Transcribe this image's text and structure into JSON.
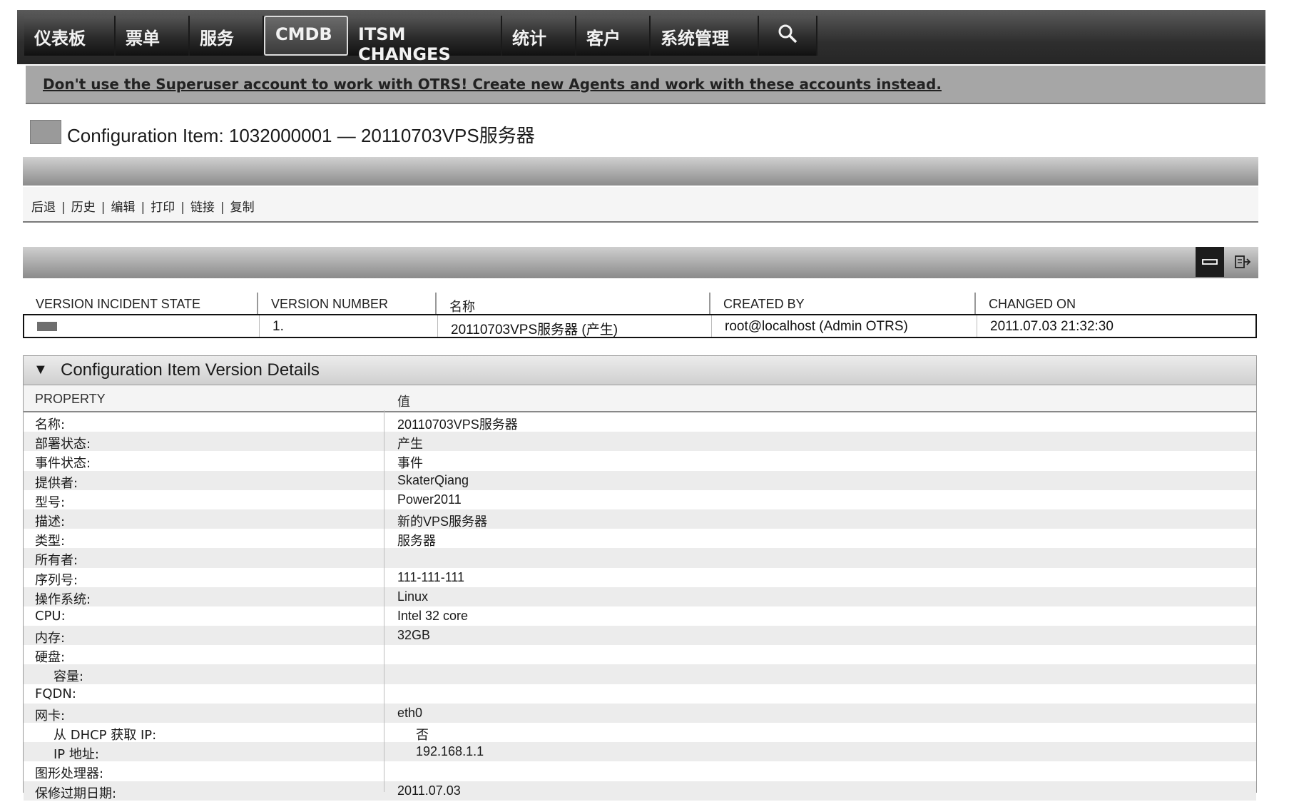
{
  "nav": {
    "items": [
      {
        "label": "仪表板"
      },
      {
        "label": "票单"
      },
      {
        "label": "服务"
      },
      {
        "label": "CMDB",
        "active": true
      },
      {
        "label": "ITSM CHANGES"
      },
      {
        "label": "统计"
      },
      {
        "label": "客户"
      },
      {
        "label": "系统管理"
      }
    ],
    "search_icon": "search-icon"
  },
  "notice": "Don't use the Superuser account to work with OTRS! Create new Agents and work with these accounts instead.",
  "page_title": "Configuration Item: 1032000001 — 20110703VPS服务器",
  "actions": [
    "后退",
    "历史",
    "编辑",
    "打印",
    "链接",
    "复制"
  ],
  "version_table": {
    "columns": [
      "VERSION INCIDENT STATE",
      "VERSION NUMBER",
      "名称",
      "CREATED BY",
      "CHANGED ON"
    ],
    "row": {
      "number": "1.",
      "name": "20110703VPS服务器 (产生)",
      "created_by": "root@localhost (Admin OTRS)",
      "changed_on": "2011.07.03 21:32:30"
    }
  },
  "details": {
    "title": "Configuration Item Version Details",
    "col_property": "PROPERTY",
    "col_value": "值",
    "rows": [
      {
        "k": "名称:",
        "v": "20110703VPS服务器"
      },
      {
        "k": "部署状态:",
        "v": "产生"
      },
      {
        "k": "事件状态:",
        "v": "事件"
      },
      {
        "k": "提供者:",
        "v": "SkaterQiang"
      },
      {
        "k": "型号:",
        "v": "Power2011"
      },
      {
        "k": "描述:",
        "v": "新的VPS服务器"
      },
      {
        "k": "类型:",
        "v": "服务器"
      },
      {
        "k": "所有者:",
        "v": ""
      },
      {
        "k": "序列号:",
        "v": "111-111-111"
      },
      {
        "k": "操作系统:",
        "v": "Linux"
      },
      {
        "k": "CPU:",
        "v": "Intel 32 core"
      },
      {
        "k": "内存:",
        "v": "32GB"
      },
      {
        "k": "硬盘:",
        "v": ""
      },
      {
        "k": "容量:",
        "v": "",
        "indent": true
      },
      {
        "k": "FQDN:",
        "v": ""
      },
      {
        "k": "网卡:",
        "v": "eth0"
      },
      {
        "k": "从 DHCP 获取 IP:",
        "v": "否",
        "indent": true
      },
      {
        "k": "IP 地址:",
        "v": "192.168.1.1",
        "indent": true
      },
      {
        "k": "图形处理器:",
        "v": ""
      },
      {
        "k": "保修过期日期:",
        "v": "2011.07.03"
      }
    ]
  }
}
